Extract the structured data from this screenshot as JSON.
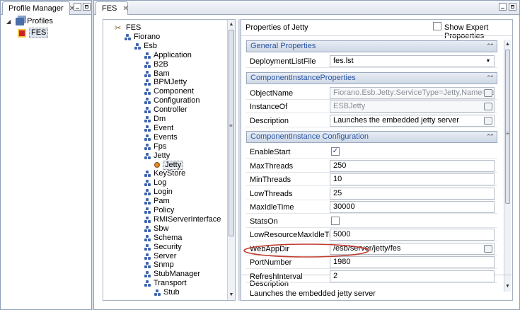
{
  "profile_manager": {
    "tab_label": "Profile Manager",
    "tree": [
      {
        "label": "Profiles",
        "level": 0
      },
      {
        "label": "FES",
        "level": 1,
        "selected": true
      }
    ]
  },
  "editor": {
    "tab_label": "FES",
    "tree": [
      {
        "label": "FES",
        "level": 0,
        "icon": "tools-icon"
      },
      {
        "label": "Fiorano",
        "level": 1
      },
      {
        "label": "Esb",
        "level": 2
      },
      {
        "label": "Application",
        "level": 3
      },
      {
        "label": "B2B",
        "level": 3
      },
      {
        "label": "Bam",
        "level": 3
      },
      {
        "label": "BPMJetty",
        "level": 3
      },
      {
        "label": "Component",
        "level": 3
      },
      {
        "label": "Configuration",
        "level": 3
      },
      {
        "label": "Controller",
        "level": 3
      },
      {
        "label": "Dm",
        "level": 3
      },
      {
        "label": "Event",
        "level": 3
      },
      {
        "label": "Events",
        "level": 3
      },
      {
        "label": "Fps",
        "level": 3
      },
      {
        "label": "Jetty",
        "level": 3
      },
      {
        "label": "Jetty",
        "level": 4,
        "selected": true
      },
      {
        "label": "KeyStore",
        "level": 3
      },
      {
        "label": "Log",
        "level": 3
      },
      {
        "label": "Login",
        "level": 3
      },
      {
        "label": "Pam",
        "level": 3
      },
      {
        "label": "Policy",
        "level": 3
      },
      {
        "label": "RMIServerInterface",
        "level": 3
      },
      {
        "label": "Sbw",
        "level": 3
      },
      {
        "label": "Schema",
        "level": 3
      },
      {
        "label": "Security",
        "level": 3
      },
      {
        "label": "Server",
        "level": 3
      },
      {
        "label": "Snmp",
        "level": 3
      },
      {
        "label": "StubManager",
        "level": 3
      },
      {
        "label": "Transport",
        "level": 3
      },
      {
        "label": "Stub",
        "level": 4
      }
    ]
  },
  "properties": {
    "title": "Properties of Jetty",
    "show_expert_label": "Show Expert Propoerties",
    "sections": [
      {
        "title": "General Properties",
        "rows": [
          {
            "label": "DeploymentListFile",
            "value": "fes.lst",
            "kind": "dropdown"
          }
        ]
      },
      {
        "title": "ComponentInstanceProperties",
        "rows": [
          {
            "label": "ObjectName",
            "value": "Fiorano.Esb.Jetty:ServiceType=Jetty,Name=Jetty",
            "kind": "readonly-ellipsis"
          },
          {
            "label": "InstanceOf",
            "value": "ESBJetty",
            "kind": "readonly-ellipsis"
          },
          {
            "label": "Description",
            "value": "Launches the embedded jetty server",
            "kind": "ellipsis"
          }
        ]
      },
      {
        "title": "ComponentInstance Configuration",
        "rows": [
          {
            "label": "EnableStart",
            "value": "",
            "kind": "check",
            "checked": true
          },
          {
            "label": "MaxThreads",
            "value": "250",
            "kind": "text"
          },
          {
            "label": "MinThreads",
            "value": "10",
            "kind": "text"
          },
          {
            "label": "LowThreads",
            "value": "25",
            "kind": "text"
          },
          {
            "label": "MaxIdleTime",
            "value": "30000",
            "kind": "text"
          },
          {
            "label": "StatsOn",
            "value": "",
            "kind": "check",
            "checked": false
          },
          {
            "label": "LowResourceMaxIdleTime",
            "value": "5000",
            "kind": "text"
          },
          {
            "label": "WebAppDir",
            "value": "/esb/server/jetty/fes",
            "kind": "ellipsis"
          },
          {
            "label": "PortNumber",
            "value": "1980",
            "kind": "text",
            "highlighted": true
          },
          {
            "label": "RefreshInterval",
            "value": "2",
            "kind": "text"
          }
        ]
      }
    ],
    "description_title": "Description",
    "description_text": "Launches the embedded jetty server"
  },
  "colors": {
    "section_header_text": "#2a55a5",
    "highlight_ellipse": "#c0392b",
    "tree_icon": "#4066b0"
  }
}
